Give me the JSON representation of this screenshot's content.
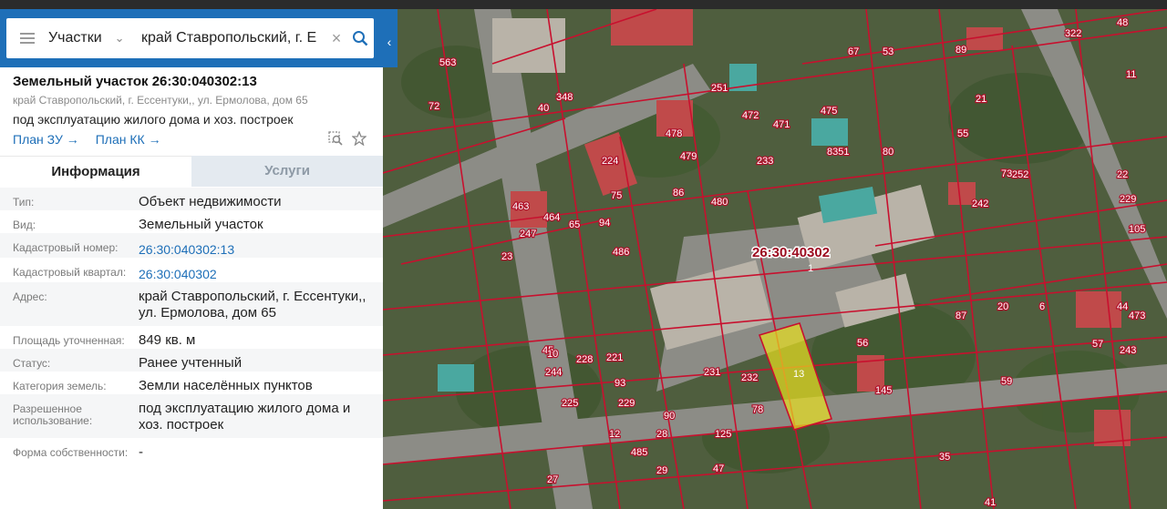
{
  "search": {
    "layer": "Участки",
    "query": "край Ставропольский, г. Е"
  },
  "object": {
    "title": "Земельный участок 26:30:040302:13",
    "address_short": "край Ставропольский, г. Ессентуки,, ул. Ермолова, дом 65",
    "purpose": "под эксплуатацию жилого дома и хоз. построек",
    "plan_zu": "План ЗУ",
    "plan_kk": "План КК"
  },
  "tabs": {
    "info": "Информация",
    "services": "Услуги"
  },
  "info_rows": [
    {
      "label": "Тип:",
      "value": "Объект недвижимости"
    },
    {
      "label": "Вид:",
      "value": "Земельный участок"
    },
    {
      "label": "Кадастровый номер:",
      "value": "26:30:040302:13"
    },
    {
      "label": "Кадастровый квартал:",
      "value": "26:30:040302"
    },
    {
      "label": "Адрес:",
      "value": "край Ставропольский, г. Ессентуки,, ул. Ермолова, дом 65"
    },
    {
      "label": "Площадь уточненная:",
      "value": "849 кв. м"
    },
    {
      "label": "Статус:",
      "value": "Ранее учтенный"
    },
    {
      "label": "Категория земель:",
      "value": "Земли населённых пунктов"
    },
    {
      "label": "Разрешенное использование:",
      "value": "под эксплуатацию жилого дома и хоз. построек"
    },
    {
      "label": "Форма собственности:",
      "value": "-"
    }
  ],
  "map": {
    "quarter_label": "26:30:40302",
    "quarter_sub": "1",
    "selected_label": "13",
    "parcel_numbers": [
      "348",
      "40",
      "72",
      "563",
      "251",
      "472",
      "471",
      "475",
      "8351",
      "80",
      "67",
      "53",
      "89",
      "48",
      "11",
      "322",
      "224",
      "478",
      "479",
      "86",
      "480",
      "233",
      "463",
      "247",
      "464",
      "65",
      "94",
      "486",
      "75",
      "23",
      "45",
      "10",
      "228",
      "221",
      "225",
      "244",
      "93",
      "229",
      "90",
      "231",
      "78",
      "232",
      "56",
      "145",
      "87",
      "57",
      "243",
      "44",
      "473",
      "6",
      "20",
      "59",
      "242",
      "252",
      "55",
      "21",
      "73",
      "22",
      "229",
      "105",
      "485",
      "28",
      "29",
      "27",
      "47",
      "125",
      "12",
      "41",
      "35"
    ],
    "colors": {
      "boundary": "#c8102e",
      "selected_fill": "#e8e020",
      "label_bg": "#ffffff"
    }
  }
}
